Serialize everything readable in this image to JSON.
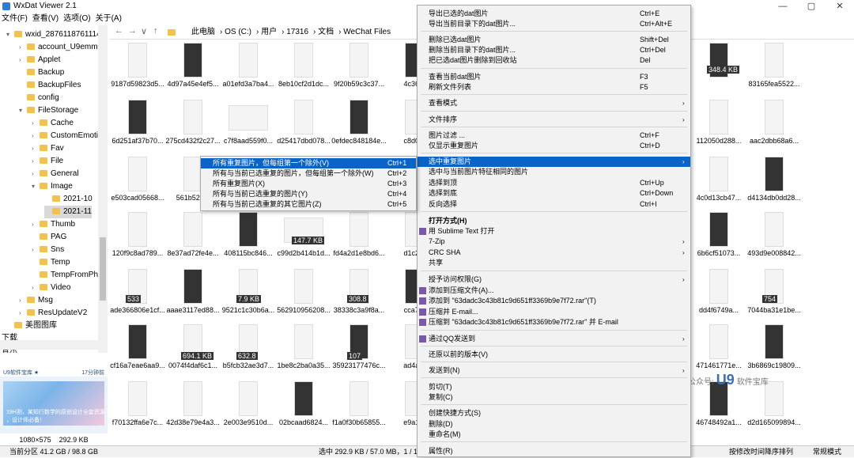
{
  "window": {
    "title": "WxDat Viewer 2.1",
    "minimize": "—",
    "maximize": "▢",
    "close": "✕"
  },
  "menubar": [
    "文件(F)",
    "查看(V)",
    "选项(O)",
    "关于(A)"
  ],
  "tree": [
    {
      "label": "wxid_2876118761114",
      "arrow": "▾"
    },
    {
      "label": "account_U9emmn",
      "arrow": "›"
    },
    {
      "label": "Applet",
      "arrow": "›"
    },
    {
      "label": "Backup",
      "arrow": ""
    },
    {
      "label": "BackupFiles",
      "arrow": ""
    },
    {
      "label": "config",
      "arrow": ""
    },
    {
      "label": "FileStorage",
      "arrow": "▾"
    },
    {
      "label": "Cache",
      "arrow": "›"
    },
    {
      "label": "CustomEmotic",
      "arrow": "›"
    },
    {
      "label": "Fav",
      "arrow": "›"
    },
    {
      "label": "File",
      "arrow": "›"
    },
    {
      "label": "General",
      "arrow": "›"
    },
    {
      "label": "Image",
      "arrow": "▾"
    },
    {
      "label": "2021-10",
      "arrow": ""
    },
    {
      "label": "2021-11",
      "arrow": ""
    },
    {
      "label": "Thumb",
      "arrow": "›"
    },
    {
      "label": "PAG",
      "arrow": ""
    },
    {
      "label": "Sns",
      "arrow": "›"
    },
    {
      "label": "Temp",
      "arrow": ""
    },
    {
      "label": "TempFromPho",
      "arrow": ""
    },
    {
      "label": "Video",
      "arrow": "›"
    },
    {
      "label": "Msg",
      "arrow": "›"
    },
    {
      "label": "ResUpdateV2",
      "arrow": "›"
    },
    {
      "label": "美图图库",
      "arrow": ""
    },
    {
      "label": "下载",
      "arrow": ""
    },
    {
      "label": "音乐",
      "arrow": ""
    }
  ],
  "preview": {
    "head": "U9软件宝库 ★",
    "head_right": "17分钟前",
    "caption_line1": "19H割，某知行数学的原创设计全套资源",
    "caption_line2": "，设计师必备！",
    "info_size": "1080×575",
    "info_bytes": "292.9 KB"
  },
  "address": {
    "back": "←",
    "forward": "→",
    "dropdown": "∨",
    "up": "↑",
    "crumbs": [
      "此电脑",
      "OS (C:)",
      "用户",
      "17316",
      "文档",
      "WeChat Files"
    ]
  },
  "files": [
    [
      "9187d59823d5...",
      "4d97a45e4ef5...",
      "a01efd3a7ba4...",
      "8eb10cf2d1dc...",
      "9f20b59c3c37...",
      "4c36..."
    ],
    [
      "6d251af37b70...",
      "275cd432f2c27...",
      "c7f8aad559f0...",
      "d25417dbd078...",
      "0efdec848184e...",
      "c8d0..."
    ],
    [
      "e503cad05668...",
      "561b52b...",
      "",
      "",
      "",
      ""
    ],
    [
      "120f9c8ad789...",
      "8e37ad72fe4e...",
      "408115bc846...",
      "c99d2b414b1d...",
      "fd4a2d1e8bd6...",
      "d1c2..."
    ],
    [
      "ade366806e1cf...",
      "aaae3117ed88...",
      "9521c1c30b6a...",
      "562910956208...",
      "38338c3a9f8a...",
      "cca7..."
    ],
    [
      "cf16a7eae6aa9...",
      "0074f4daf6c1...",
      "b5fcb32ae3d7...",
      "1be8c2ba0a35...",
      "35923177476c...",
      "ad4a..."
    ],
    [
      "f70132ffa6e7c...",
      "42d38e79e4a3...",
      "2e003e9510d...",
      "02bcaad6824...",
      "f1a0f30b65855...",
      "e9a1..."
    ]
  ],
  "files_right": [
    [
      "",
      "83165fea5522..."
    ],
    [
      "112050d288...",
      "aac2dbb68a6..."
    ],
    [
      "4c0d13cb47...",
      "d4134db0dd28..."
    ],
    [
      "6b6cf51073...",
      "493d9e008842..."
    ],
    [
      "dd4f6749a...",
      "7044ba31e1be..."
    ],
    [
      "471461771e...",
      "3b6869c19809..."
    ],
    [
      "46748492a1...",
      "d2d165099894..."
    ]
  ],
  "badges": [
    "348.4 KB",
    "147.7 KB",
    "694.1 KB",
    "632.8",
    "308.8",
    "533",
    "7.9 KB",
    "107",
    "754"
  ],
  "context_menu": [
    {
      "label": "导出已选的dat图片",
      "shortcut": "Ctrl+E"
    },
    {
      "label": "导出当前目录下的dat图片...",
      "shortcut": "Ctrl+Alt+E"
    },
    {
      "label": "删除已选dat图片",
      "shortcut": "Shift+Del"
    },
    {
      "label": "删除当前目录下的dat图片...",
      "shortcut": "Ctrl+Del"
    },
    {
      "label": "把已选dat图片删除到回收站",
      "shortcut": "Del"
    },
    {
      "label": "查看当前dat图片",
      "shortcut": "F3"
    },
    {
      "label": "刷新文件列表",
      "shortcut": "F5"
    },
    {
      "label": "查看模式",
      "shortcut": "",
      "arrow": "›"
    },
    {
      "label": "文件排序",
      "shortcut": "",
      "arrow": "›"
    },
    {
      "label": "图片过滤 ...",
      "shortcut": "Ctrl+F"
    },
    {
      "label": "仅显示重复图片",
      "shortcut": "Ctrl+D"
    },
    {
      "label": "选中重复图片",
      "shortcut": "",
      "arrow": "›"
    },
    {
      "label": "选中与当前图片特征相同的图片",
      "shortcut": ""
    },
    {
      "label": "选择到顶",
      "shortcut": "Ctrl+Up"
    },
    {
      "label": "选择到底",
      "shortcut": "Ctrl+Down"
    },
    {
      "label": "反向选择",
      "shortcut": "Ctrl+I"
    },
    {
      "label": "打开方式(H)",
      "shortcut": ""
    },
    {
      "label": "用 Sublime Text 打开",
      "shortcut": ""
    },
    {
      "label": "7-Zip",
      "shortcut": "",
      "arrow": "›"
    },
    {
      "label": "CRC SHA",
      "shortcut": "",
      "arrow": "›"
    },
    {
      "label": "共享",
      "shortcut": ""
    },
    {
      "label": "授予访问权限(G)",
      "shortcut": "",
      "arrow": "›"
    },
    {
      "label": "添加到压缩文件(A)...",
      "shortcut": ""
    },
    {
      "label": "添加到 \"63dadc3c43b81c9d651ff3369b9e7f72.rar\"(T)",
      "shortcut": ""
    },
    {
      "label": "压缩并 E-mail...",
      "shortcut": ""
    },
    {
      "label": "压缩到 \"63dadc3c43b81c9d651ff3369b9e7f72.rar\" 并 E-mail",
      "shortcut": ""
    },
    {
      "label": "通过QQ发送到",
      "shortcut": "",
      "arrow": "›"
    },
    {
      "label": "还原以前的版本(V)",
      "shortcut": ""
    },
    {
      "label": "发送到(N)",
      "shortcut": "",
      "arrow": "›"
    },
    {
      "label": "剪切(T)",
      "shortcut": ""
    },
    {
      "label": "复制(C)",
      "shortcut": ""
    },
    {
      "label": "创建快捷方式(S)",
      "shortcut": ""
    },
    {
      "label": "删除(D)",
      "shortcut": ""
    },
    {
      "label": "重命名(M)",
      "shortcut": ""
    },
    {
      "label": "属性(R)",
      "shortcut": ""
    }
  ],
  "submenu": [
    {
      "label": "所有重复图片，但每组第一个除外(V)",
      "shortcut": "Ctrl+1"
    },
    {
      "label": "所有与当前已选重复的图片，但每组第一个除外(W)",
      "shortcut": "Ctrl+2"
    },
    {
      "label": "所有重复图片(X)",
      "shortcut": "Ctrl+3"
    },
    {
      "label": "所有与当前已选重复的图片(Y)",
      "shortcut": "Ctrl+4"
    },
    {
      "label": "所有与当前已选重复的其它图片(Z)",
      "shortcut": "Ctrl+5"
    }
  ],
  "watermark": {
    "prefix": "公众号:",
    "brand": "U9",
    "suffix": "软件宝库"
  },
  "status": {
    "left": "当前分区 41.2 GB / 98.8 GB",
    "mid": "选中 292.9 KB / 57.0 MB，1 / 1",
    "sort": "按修改时间降序排列",
    "mode": "常规模式"
  },
  "colors": {
    "highlight": "#0a64c8",
    "folder": "#f2c14e"
  }
}
